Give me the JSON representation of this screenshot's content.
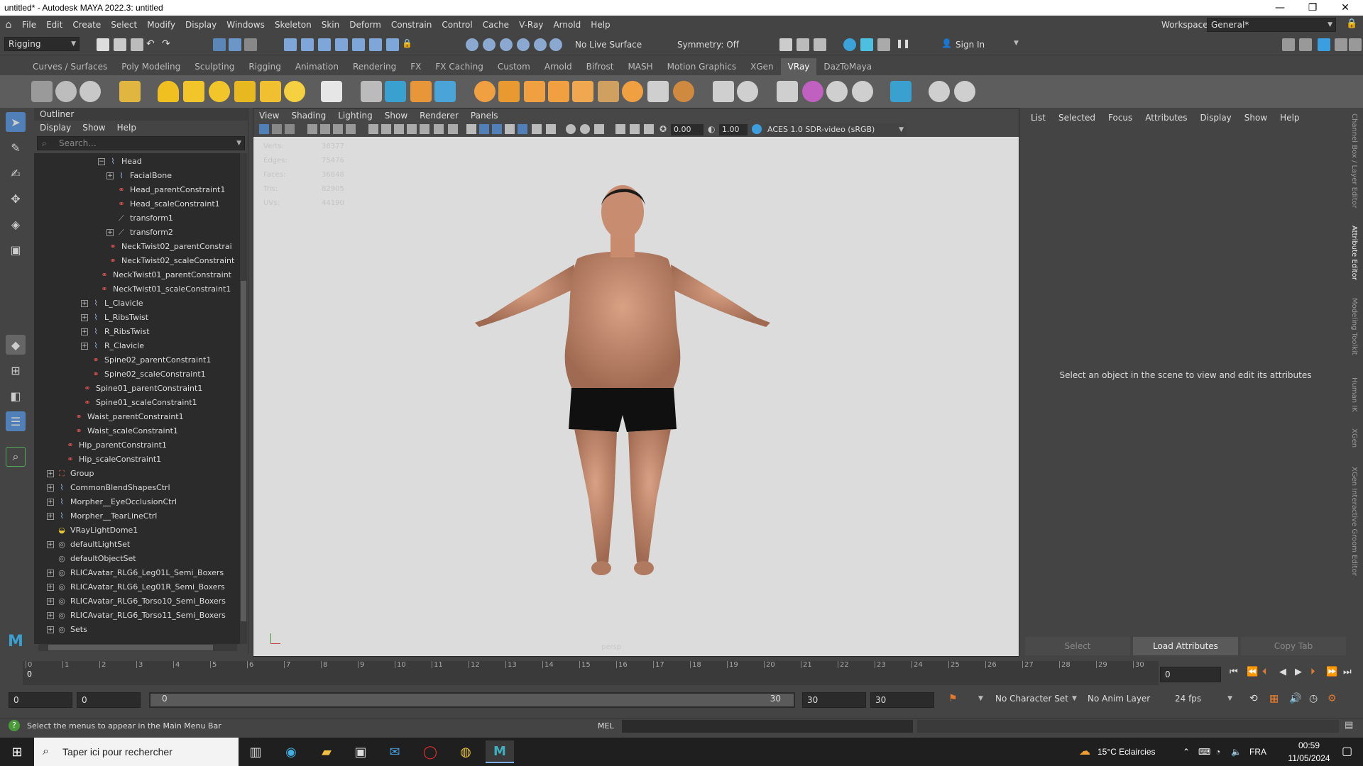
{
  "window": {
    "title": "untitled* - Autodesk MAYA 2022.3: untitled",
    "minimize": "—",
    "maximize": "❐",
    "close": "✕"
  },
  "menubar": {
    "items": [
      "File",
      "Edit",
      "Create",
      "Select",
      "Modify",
      "Display",
      "Windows",
      "Skeleton",
      "Skin",
      "Deform",
      "Constrain",
      "Control",
      "Cache",
      "V-Ray",
      "Arnold",
      "Help"
    ],
    "workspace_label": "Workspace:",
    "workspace_value": "General*"
  },
  "statusline": {
    "menuset": "Rigging",
    "live_surface": "No Live Surface",
    "symmetry": "Symmetry: Off",
    "sign_in": "Sign In"
  },
  "shelf": {
    "tabs": [
      "Curves / Surfaces",
      "Poly Modeling",
      "Sculpting",
      "Rigging",
      "Animation",
      "Rendering",
      "FX",
      "FX Caching",
      "Custom",
      "Arnold",
      "Bifrost",
      "MASH",
      "Motion Graphics",
      "XGen",
      "VRay",
      "DazToMaya"
    ],
    "active_tab": "VRay"
  },
  "outliner": {
    "title": "Outliner",
    "menu": [
      "Display",
      "Show",
      "Help"
    ],
    "search_placeholder": "Search...",
    "rows": [
      {
        "label": "Head",
        "icon": "joint",
        "depth": 7,
        "expander": "−"
      },
      {
        "label": "FacialBone",
        "icon": "joint",
        "depth": 8,
        "expander": "+"
      },
      {
        "label": "Head_parentConstraint1",
        "icon": "constraint",
        "depth": 8,
        "expander": ""
      },
      {
        "label": "Head_scaleConstraint1",
        "icon": "constraint",
        "depth": 8,
        "expander": ""
      },
      {
        "label": "transform1",
        "icon": "transform",
        "depth": 8,
        "expander": ""
      },
      {
        "label": "transform2",
        "icon": "transform",
        "depth": 8,
        "expander": "+"
      },
      {
        "label": "NeckTwist02_parentConstrai",
        "icon": "constraint",
        "depth": 7,
        "expander": ""
      },
      {
        "label": "NeckTwist02_scaleConstraint",
        "icon": "constraint",
        "depth": 7,
        "expander": ""
      },
      {
        "label": "NeckTwist01_parentConstraint",
        "icon": "constraint",
        "depth": 6,
        "expander": ""
      },
      {
        "label": "NeckTwist01_scaleConstraint1",
        "icon": "constraint",
        "depth": 6,
        "expander": ""
      },
      {
        "label": "L_Clavicle",
        "icon": "joint",
        "depth": 5,
        "expander": "+"
      },
      {
        "label": "L_RibsTwist",
        "icon": "joint",
        "depth": 5,
        "expander": "+"
      },
      {
        "label": "R_RibsTwist",
        "icon": "joint",
        "depth": 5,
        "expander": "+"
      },
      {
        "label": "R_Clavicle",
        "icon": "joint",
        "depth": 5,
        "expander": "+"
      },
      {
        "label": "Spine02_parentConstraint1",
        "icon": "constraint",
        "depth": 5,
        "expander": ""
      },
      {
        "label": "Spine02_scaleConstraint1",
        "icon": "constraint",
        "depth": 5,
        "expander": ""
      },
      {
        "label": "Spine01_parentConstraint1",
        "icon": "constraint",
        "depth": 4,
        "expander": ""
      },
      {
        "label": "Spine01_scaleConstraint1",
        "icon": "constraint",
        "depth": 4,
        "expander": ""
      },
      {
        "label": "Waist_parentConstraint1",
        "icon": "constraint",
        "depth": 3,
        "expander": ""
      },
      {
        "label": "Waist_scaleConstraint1",
        "icon": "constraint",
        "depth": 3,
        "expander": ""
      },
      {
        "label": "Hip_parentConstraint1",
        "icon": "constraint",
        "depth": 2,
        "expander": ""
      },
      {
        "label": "Hip_scaleConstraint1",
        "icon": "constraint",
        "depth": 2,
        "expander": ""
      },
      {
        "label": "Group",
        "icon": "group",
        "depth": 1,
        "expander": "+"
      },
      {
        "label": "CommonBlendShapesCtrl",
        "icon": "joint",
        "depth": 1,
        "expander": "+"
      },
      {
        "label": "Morpher__EyeOcclusionCtrl",
        "icon": "joint",
        "depth": 1,
        "expander": "+"
      },
      {
        "label": "Morpher__TearLineCtrl",
        "icon": "joint",
        "depth": 1,
        "expander": "+"
      },
      {
        "label": "VRayLightDome1",
        "icon": "light",
        "depth": 1,
        "expander": ""
      },
      {
        "label": "defaultLightSet",
        "icon": "set",
        "depth": 1,
        "expander": "+"
      },
      {
        "label": "defaultObjectSet",
        "icon": "set",
        "depth": 1,
        "expander": ""
      },
      {
        "label": "RLICAvatar_RLG6_Leg01L_Semi_Boxers",
        "icon": "set",
        "depth": 1,
        "expander": "+"
      },
      {
        "label": "RLICAvatar_RLG6_Leg01R_Semi_Boxers",
        "icon": "set",
        "depth": 1,
        "expander": "+"
      },
      {
        "label": "RLICAvatar_RLG6_Torso10_Semi_Boxers",
        "icon": "set",
        "depth": 1,
        "expander": "+"
      },
      {
        "label": "RLICAvatar_RLG6_Torso11_Semi_Boxers",
        "icon": "set",
        "depth": 1,
        "expander": "+"
      },
      {
        "label": "Sets",
        "icon": "set",
        "depth": 1,
        "expander": "+"
      }
    ]
  },
  "viewport": {
    "menu": [
      "View",
      "Shading",
      "Lighting",
      "Show",
      "Renderer",
      "Panels"
    ],
    "field_a": "0.00",
    "field_b": "1.00",
    "color_space": "ACES 1.0 SDR-video (sRGB)",
    "hud_labels": [
      "Verts:",
      "Edges:",
      "Faces:",
      "Tris:",
      "UVs:"
    ],
    "hud_values": [
      "38377",
      "75476",
      "36848",
      "82905",
      "44190"
    ],
    "camera_label": "persp"
  },
  "attribute_editor": {
    "menu": [
      "List",
      "Selected",
      "Focus",
      "Attributes",
      "Display",
      "Show",
      "Help"
    ],
    "message": "Select an object in the scene to view and edit its attributes",
    "buttons": [
      "Select",
      "Load Attributes",
      "Copy Tab"
    ]
  },
  "side_tabs": [
    "Channel Box / Layer Editor",
    "Attribute Editor",
    "Modeling Toolkit",
    "Human IK",
    "XGen",
    "XGen Interactive Groom Editor"
  ],
  "timeslider": {
    "ticks": [
      "0",
      "1",
      "2",
      "3",
      "4",
      "5",
      "6",
      "7",
      "8",
      "9",
      "10",
      "11",
      "12",
      "13",
      "14",
      "15",
      "16",
      "17",
      "18",
      "19",
      "20",
      "21",
      "22",
      "23",
      "24",
      "25",
      "26",
      "27",
      "28",
      "29",
      "30"
    ],
    "current_frame": "0",
    "current_frame_field": "0"
  },
  "rangeslider": {
    "start": "0",
    "playback_start": "0",
    "range_start": "0",
    "range_end": "30",
    "playback_end": "30",
    "end": "30",
    "character_set": "No Character Set",
    "anim_layer": "No Anim Layer",
    "fps": "24 fps"
  },
  "commandline": {
    "help": "Select the menus to appear in the Main Menu Bar",
    "lang": "MEL"
  },
  "taskbar": {
    "search": "Taper ici pour rechercher",
    "weather": "15°C  Eclaircies",
    "lang": "FRA",
    "time": "00:59",
    "date": "11/05/2024"
  }
}
